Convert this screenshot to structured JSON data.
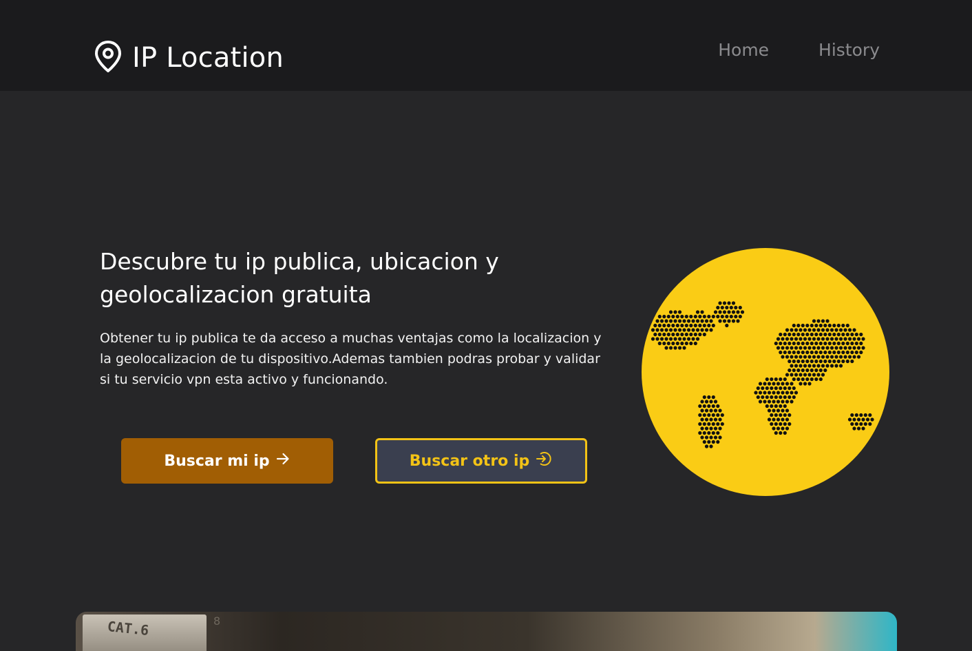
{
  "header": {
    "brand_icon": "map-pin-icon",
    "title": "IP Location",
    "nav": [
      {
        "label": "Home"
      },
      {
        "label": "History"
      }
    ]
  },
  "hero": {
    "title": "Descubre tu ip publica, ubicacion y geolocalizacion gratuita",
    "description": "Obtener tu ip publica te da acceso a muchas ventajas como la localizacion y la geolocalizacion de tu dispositivo.Ademas tambien podras probar y validar si tu servicio vpn esta activo y funcionando.",
    "primary_button": {
      "label": "Buscar mi ip",
      "icon": "arrow-right-icon"
    },
    "secondary_button": {
      "label": "Buscar otro ip",
      "icon": "login-circle-icon"
    },
    "illustration": "world-map-globe-icon"
  },
  "photo": {
    "label": "CAT.6",
    "number": "8"
  },
  "colors": {
    "header_bg": "#1b1b1d",
    "page_bg": "#262628",
    "primary": "#a15e04",
    "accent": "#f3c316",
    "secondary_bg": "#3a3f4f",
    "globe": "#facc15"
  }
}
